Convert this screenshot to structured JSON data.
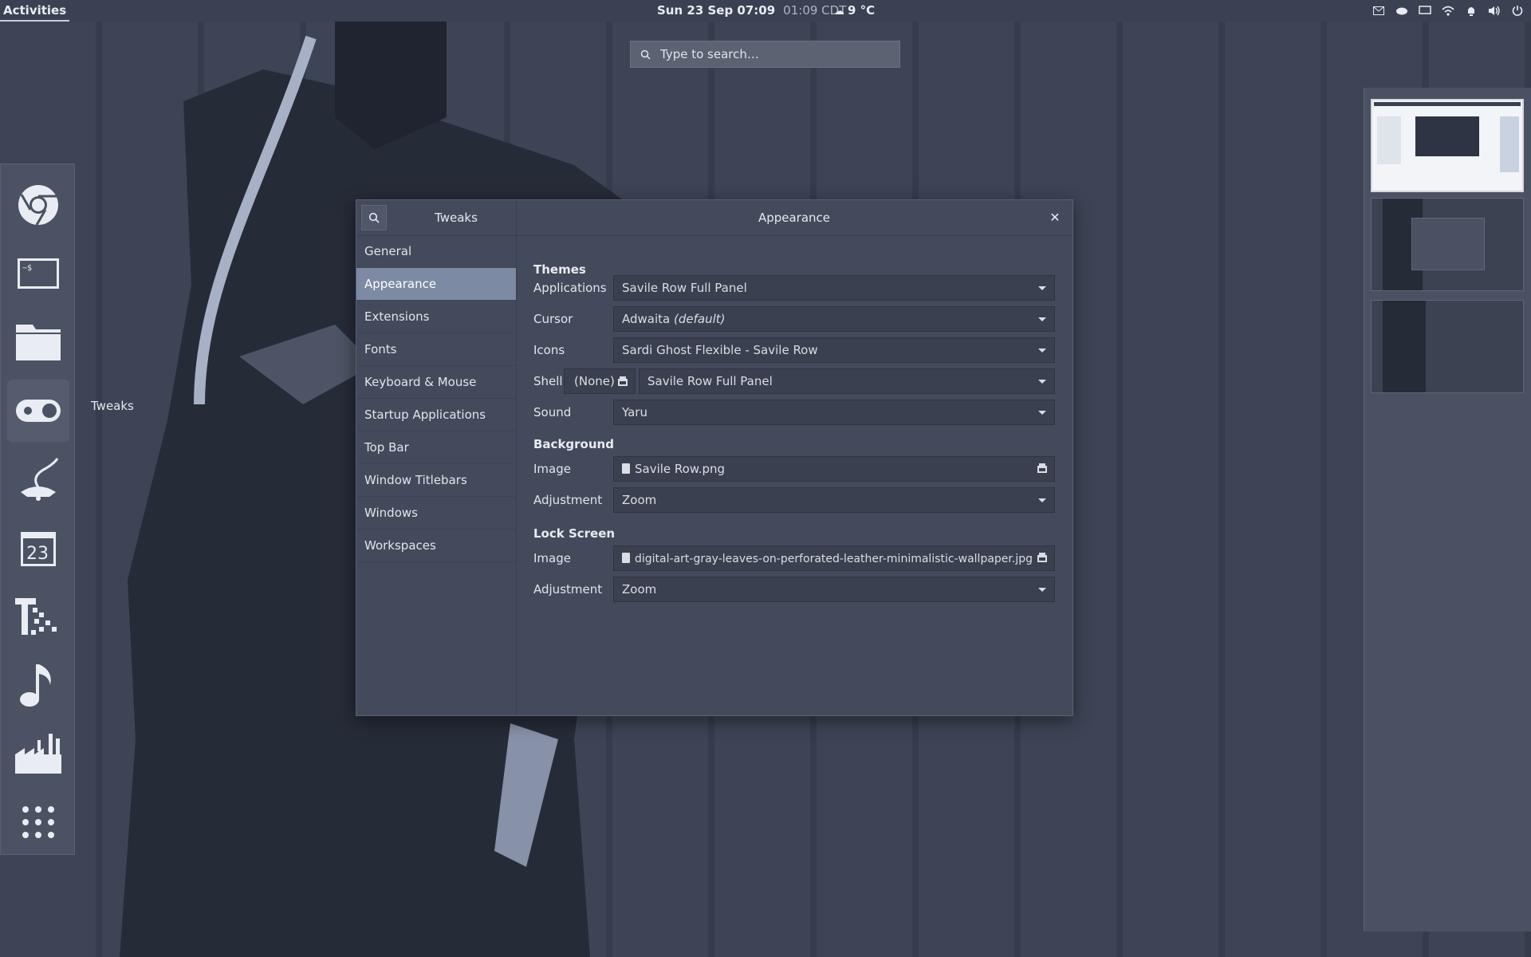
{
  "topbar": {
    "activities": "Activities",
    "date_time": "Sun 23 Sep  07:09",
    "secondary_time": "01:09 CDT",
    "weather": "9 °C",
    "tray_icons": [
      "mail-icon",
      "cloud-icon",
      "display-icon",
      "wifi-icon",
      "notification-icon",
      "volume-icon",
      "power-icon"
    ]
  },
  "search": {
    "placeholder": "Type to search…"
  },
  "dash": {
    "tooltip": "Tweaks",
    "apps": [
      "chrome-icon",
      "terminal-icon",
      "files-icon",
      "tweaks-icon",
      "genie-lamp-icon",
      "calendar-icon",
      "pixel-app-icon",
      "music-icon",
      "factory-icon",
      "app-grid-icon"
    ]
  },
  "window": {
    "app_title": "Tweaks",
    "panel_title": "Appearance",
    "nav": [
      "General",
      "Appearance",
      "Extensions",
      "Fonts",
      "Keyboard & Mouse",
      "Startup Applications",
      "Top Bar",
      "Window Titlebars",
      "Windows",
      "Workspaces"
    ],
    "selected_nav": "Appearance",
    "sections": {
      "themes": "Themes",
      "background": "Background",
      "lock_screen": "Lock Screen"
    },
    "themes": {
      "applications_label": "Applications",
      "applications_value": "Savile Row Full Panel",
      "cursor_label": "Cursor",
      "cursor_value": "Adwaita",
      "cursor_default": "(default)",
      "icons_label": "Icons",
      "icons_value": "Sardi Ghost Flexible - Savile Row",
      "shell_label": "Shell",
      "shell_none": "(None)",
      "shell_value": "Savile Row Full Panel",
      "sound_label": "Sound",
      "sound_value": "Yaru"
    },
    "background": {
      "image_label": "Image",
      "image_value": "Savile Row.png",
      "adjustment_label": "Adjustment",
      "adjustment_value": "Zoom"
    },
    "lock_screen": {
      "image_label": "Image",
      "image_value": "digital-art-gray-leaves-on-perforated-leather-minimalistic-wallpaper.jpg",
      "adjustment_label": "Adjustment",
      "adjustment_value": "Zoom"
    }
  }
}
